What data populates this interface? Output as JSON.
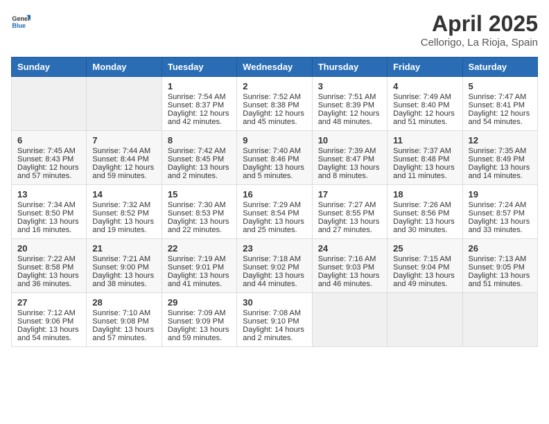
{
  "header": {
    "logo_general": "General",
    "logo_blue": "Blue",
    "title": "April 2025",
    "subtitle": "Cellorigo, La Rioja, Spain"
  },
  "weekdays": [
    "Sunday",
    "Monday",
    "Tuesday",
    "Wednesday",
    "Thursday",
    "Friday",
    "Saturday"
  ],
  "weeks": [
    [
      {
        "day": "",
        "sunrise": "",
        "sunset": "",
        "daylight": "",
        "empty": true
      },
      {
        "day": "",
        "sunrise": "",
        "sunset": "",
        "daylight": "",
        "empty": true
      },
      {
        "day": "1",
        "sunrise": "Sunrise: 7:54 AM",
        "sunset": "Sunset: 8:37 PM",
        "daylight": "Daylight: 12 hours and 42 minutes."
      },
      {
        "day": "2",
        "sunrise": "Sunrise: 7:52 AM",
        "sunset": "Sunset: 8:38 PM",
        "daylight": "Daylight: 12 hours and 45 minutes."
      },
      {
        "day": "3",
        "sunrise": "Sunrise: 7:51 AM",
        "sunset": "Sunset: 8:39 PM",
        "daylight": "Daylight: 12 hours and 48 minutes."
      },
      {
        "day": "4",
        "sunrise": "Sunrise: 7:49 AM",
        "sunset": "Sunset: 8:40 PM",
        "daylight": "Daylight: 12 hours and 51 minutes."
      },
      {
        "day": "5",
        "sunrise": "Sunrise: 7:47 AM",
        "sunset": "Sunset: 8:41 PM",
        "daylight": "Daylight: 12 hours and 54 minutes."
      }
    ],
    [
      {
        "day": "6",
        "sunrise": "Sunrise: 7:45 AM",
        "sunset": "Sunset: 8:43 PM",
        "daylight": "Daylight: 12 hours and 57 minutes."
      },
      {
        "day": "7",
        "sunrise": "Sunrise: 7:44 AM",
        "sunset": "Sunset: 8:44 PM",
        "daylight": "Daylight: 12 hours and 59 minutes."
      },
      {
        "day": "8",
        "sunrise": "Sunrise: 7:42 AM",
        "sunset": "Sunset: 8:45 PM",
        "daylight": "Daylight: 13 hours and 2 minutes."
      },
      {
        "day": "9",
        "sunrise": "Sunrise: 7:40 AM",
        "sunset": "Sunset: 8:46 PM",
        "daylight": "Daylight: 13 hours and 5 minutes."
      },
      {
        "day": "10",
        "sunrise": "Sunrise: 7:39 AM",
        "sunset": "Sunset: 8:47 PM",
        "daylight": "Daylight: 13 hours and 8 minutes."
      },
      {
        "day": "11",
        "sunrise": "Sunrise: 7:37 AM",
        "sunset": "Sunset: 8:48 PM",
        "daylight": "Daylight: 13 hours and 11 minutes."
      },
      {
        "day": "12",
        "sunrise": "Sunrise: 7:35 AM",
        "sunset": "Sunset: 8:49 PM",
        "daylight": "Daylight: 13 hours and 14 minutes."
      }
    ],
    [
      {
        "day": "13",
        "sunrise": "Sunrise: 7:34 AM",
        "sunset": "Sunset: 8:50 PM",
        "daylight": "Daylight: 13 hours and 16 minutes."
      },
      {
        "day": "14",
        "sunrise": "Sunrise: 7:32 AM",
        "sunset": "Sunset: 8:52 PM",
        "daylight": "Daylight: 13 hours and 19 minutes."
      },
      {
        "day": "15",
        "sunrise": "Sunrise: 7:30 AM",
        "sunset": "Sunset: 8:53 PM",
        "daylight": "Daylight: 13 hours and 22 minutes."
      },
      {
        "day": "16",
        "sunrise": "Sunrise: 7:29 AM",
        "sunset": "Sunset: 8:54 PM",
        "daylight": "Daylight: 13 hours and 25 minutes."
      },
      {
        "day": "17",
        "sunrise": "Sunrise: 7:27 AM",
        "sunset": "Sunset: 8:55 PM",
        "daylight": "Daylight: 13 hours and 27 minutes."
      },
      {
        "day": "18",
        "sunrise": "Sunrise: 7:26 AM",
        "sunset": "Sunset: 8:56 PM",
        "daylight": "Daylight: 13 hours and 30 minutes."
      },
      {
        "day": "19",
        "sunrise": "Sunrise: 7:24 AM",
        "sunset": "Sunset: 8:57 PM",
        "daylight": "Daylight: 13 hours and 33 minutes."
      }
    ],
    [
      {
        "day": "20",
        "sunrise": "Sunrise: 7:22 AM",
        "sunset": "Sunset: 8:58 PM",
        "daylight": "Daylight: 13 hours and 36 minutes."
      },
      {
        "day": "21",
        "sunrise": "Sunrise: 7:21 AM",
        "sunset": "Sunset: 9:00 PM",
        "daylight": "Daylight: 13 hours and 38 minutes."
      },
      {
        "day": "22",
        "sunrise": "Sunrise: 7:19 AM",
        "sunset": "Sunset: 9:01 PM",
        "daylight": "Daylight: 13 hours and 41 minutes."
      },
      {
        "day": "23",
        "sunrise": "Sunrise: 7:18 AM",
        "sunset": "Sunset: 9:02 PM",
        "daylight": "Daylight: 13 hours and 44 minutes."
      },
      {
        "day": "24",
        "sunrise": "Sunrise: 7:16 AM",
        "sunset": "Sunset: 9:03 PM",
        "daylight": "Daylight: 13 hours and 46 minutes."
      },
      {
        "day": "25",
        "sunrise": "Sunrise: 7:15 AM",
        "sunset": "Sunset: 9:04 PM",
        "daylight": "Daylight: 13 hours and 49 minutes."
      },
      {
        "day": "26",
        "sunrise": "Sunrise: 7:13 AM",
        "sunset": "Sunset: 9:05 PM",
        "daylight": "Daylight: 13 hours and 51 minutes."
      }
    ],
    [
      {
        "day": "27",
        "sunrise": "Sunrise: 7:12 AM",
        "sunset": "Sunset: 9:06 PM",
        "daylight": "Daylight: 13 hours and 54 minutes."
      },
      {
        "day": "28",
        "sunrise": "Sunrise: 7:10 AM",
        "sunset": "Sunset: 9:08 PM",
        "daylight": "Daylight: 13 hours and 57 minutes."
      },
      {
        "day": "29",
        "sunrise": "Sunrise: 7:09 AM",
        "sunset": "Sunset: 9:09 PM",
        "daylight": "Daylight: 13 hours and 59 minutes."
      },
      {
        "day": "30",
        "sunrise": "Sunrise: 7:08 AM",
        "sunset": "Sunset: 9:10 PM",
        "daylight": "Daylight: 14 hours and 2 minutes."
      },
      {
        "day": "",
        "sunrise": "",
        "sunset": "",
        "daylight": "",
        "empty": true
      },
      {
        "day": "",
        "sunrise": "",
        "sunset": "",
        "daylight": "",
        "empty": true
      },
      {
        "day": "",
        "sunrise": "",
        "sunset": "",
        "daylight": "",
        "empty": true
      }
    ]
  ]
}
